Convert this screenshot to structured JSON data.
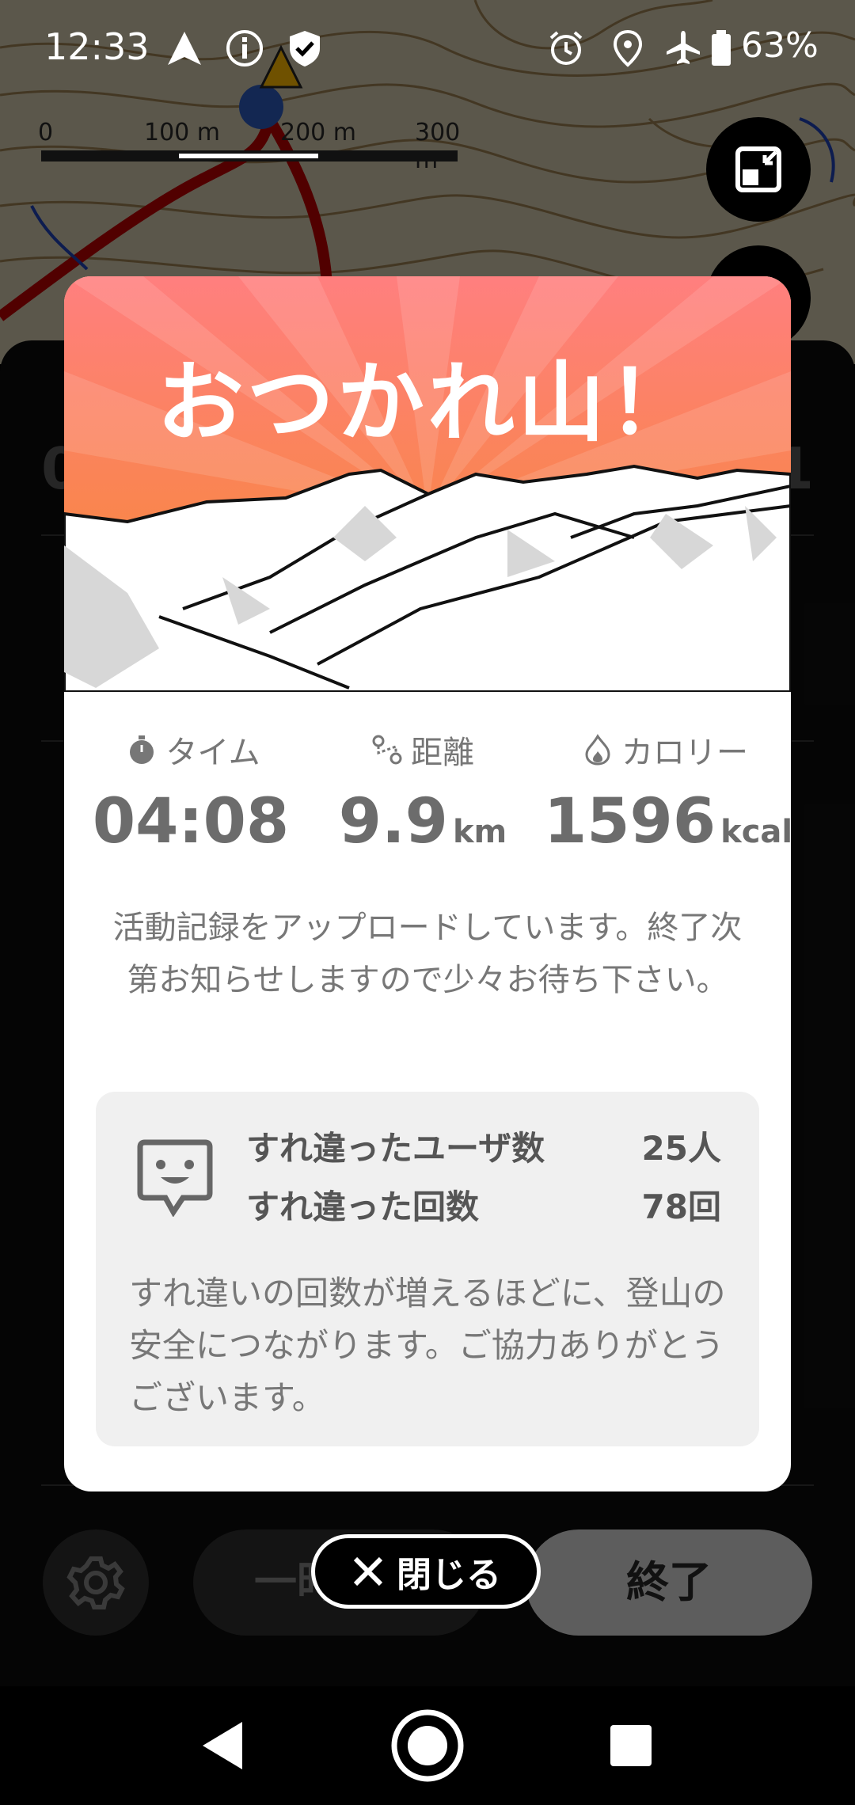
{
  "status_bar": {
    "time": "12:33",
    "battery": "63%",
    "icons": [
      "navigation-icon",
      "info-icon",
      "shield-icon",
      "alarm-icon",
      "location-icon",
      "airplane-icon",
      "battery-icon"
    ]
  },
  "map": {
    "scale_labels": [
      "0",
      "100 m",
      "200 m",
      "300 m"
    ],
    "buttons": [
      "collapse-map-icon",
      "map-layer-icon"
    ]
  },
  "dialog": {
    "title": "おつかれ山！",
    "stats": [
      {
        "icon": "stopwatch-icon",
        "label": "タイム",
        "value": "04:08",
        "unit": ""
      },
      {
        "icon": "route-icon",
        "label": "距離",
        "value": "9.9",
        "unit": "km"
      },
      {
        "icon": "flame-icon",
        "label": "カロリー",
        "value": "1596",
        "unit": "kcal"
      }
    ],
    "upload_message": "活動記録をアップロードしています。終了次第お知らせしますので少々お待ち下さい。",
    "passing": {
      "icon": "smile-chat-icon",
      "users_label": "すれ違ったユーザ数",
      "users_value": "25人",
      "count_label": "すれ違った回数",
      "count_value": "78回",
      "note": "すれ違いの回数が増えるほどに、登山の安全につながります。ご協力ありがとうございます。"
    }
  },
  "controls": {
    "pause_label": "一時停止",
    "end_label": "終了",
    "close_label": "閉じる"
  },
  "colors": {
    "hero_top": "#ff7f7f",
    "hero_bottom": "#f58a2a",
    "sheet": "#0d0d0d"
  }
}
